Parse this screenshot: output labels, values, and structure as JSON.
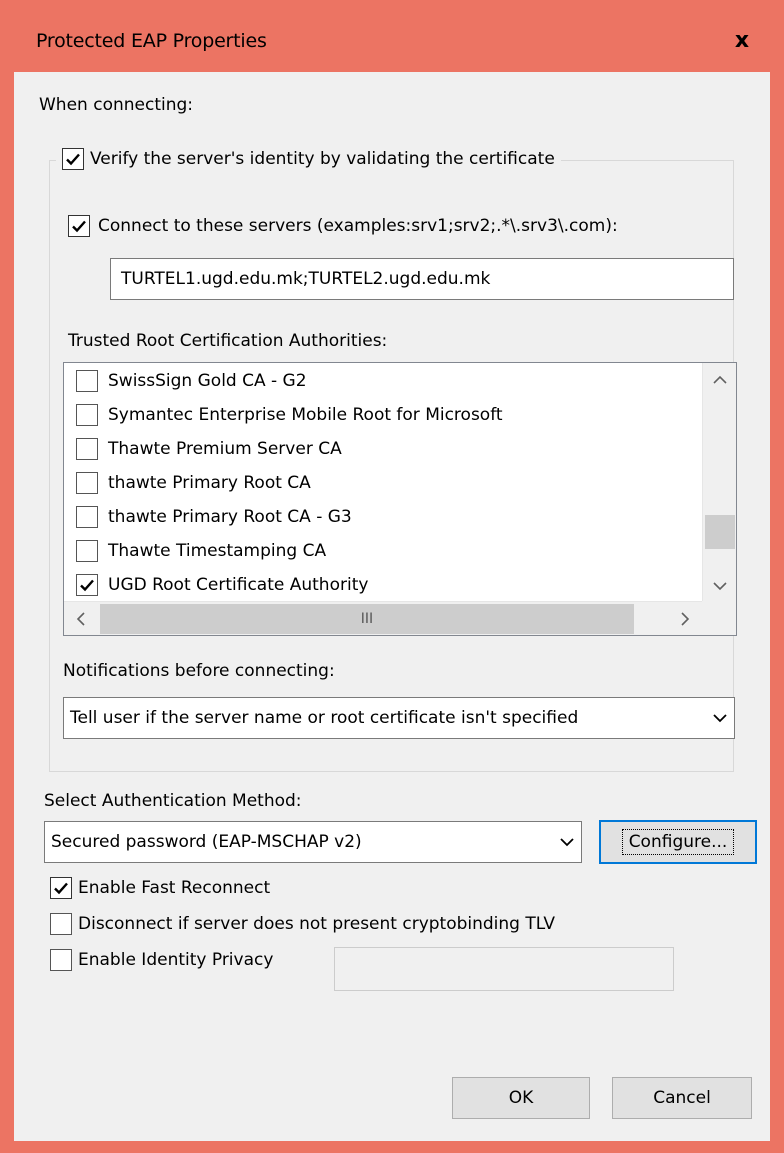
{
  "window": {
    "title": "Protected EAP Properties",
    "close_label": "x",
    "frame_color": "#ec7463"
  },
  "when_connecting_label": "When connecting:",
  "verify_server": {
    "checked": true,
    "label": "Verify the server's identity by validating the certificate"
  },
  "connect_servers": {
    "checked": true,
    "label": "Connect to these servers (examples:srv1;srv2;.*\\.srv3\\.com):",
    "value": "TURTEL1.ugd.edu.mk;TURTEL2.ugd.edu.mk"
  },
  "trusted_root": {
    "label": "Trusted Root Certification Authorities:",
    "items": [
      {
        "label": "SwissSign Gold CA - G2",
        "checked": false
      },
      {
        "label": "Symantec Enterprise Mobile Root for Microsoft",
        "checked": false
      },
      {
        "label": "Thawte Premium Server CA",
        "checked": false
      },
      {
        "label": "thawte Primary Root CA",
        "checked": false
      },
      {
        "label": "thawte Primary Root CA - G3",
        "checked": false
      },
      {
        "label": "Thawte Timestamping CA",
        "checked": false
      },
      {
        "label": "UGD Root Certificate Authority",
        "checked": true
      }
    ],
    "hscroll_grip": "III"
  },
  "notifications": {
    "label": "Notifications before connecting:",
    "selected": "Tell user if the server name or root certificate isn't specified"
  },
  "auth_method": {
    "label": "Select Authentication Method:",
    "selected": "Secured password (EAP-MSCHAP v2)",
    "configure_label": "Configure..."
  },
  "options": {
    "fast_reconnect": {
      "checked": true,
      "label": "Enable Fast Reconnect"
    },
    "cryptobinding": {
      "checked": false,
      "label": "Disconnect if server does not present cryptobinding TLV"
    },
    "identity_privacy": {
      "checked": false,
      "label": "Enable Identity Privacy"
    }
  },
  "buttons": {
    "ok": "OK",
    "cancel": "Cancel"
  }
}
